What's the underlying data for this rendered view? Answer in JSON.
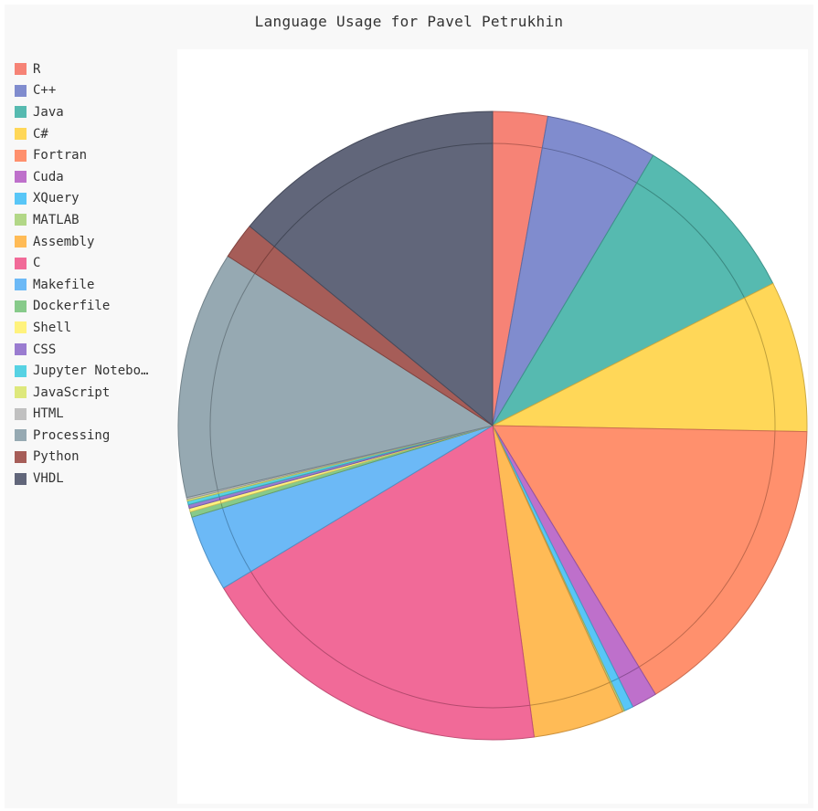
{
  "title": "Language Usage for Pavel Petrukhin",
  "chart_data": {
    "type": "pie",
    "title": "Language Usage for Pavel Petrukhin",
    "legend_position": "left",
    "slices": [
      {
        "label": "R",
        "value": 3.0,
        "color": "#F57C6F"
      },
      {
        "label": "C++",
        "value": 6.1,
        "color": "#7986CB"
      },
      {
        "label": "Java",
        "value": 9.6,
        "color": "#4DB6AC"
      },
      {
        "label": "C#",
        "value": 8.3,
        "color": "#FFD54F"
      },
      {
        "label": "Fortran",
        "value": 17.1,
        "color": "#FF8A65"
      },
      {
        "label": "Cuda",
        "value": 1.4,
        "color": "#BA68C8"
      },
      {
        "label": "XQuery",
        "value": 0.5,
        "color": "#4FC3F7"
      },
      {
        "label": "MATLAB",
        "value": 0.1,
        "color": "#AED581"
      },
      {
        "label": "Assembly",
        "value": 5.0,
        "color": "#FFB74D"
      },
      {
        "label": "C",
        "value": 19.7,
        "color": "#F06292"
      },
      {
        "label": "Makefile",
        "value": 4.2,
        "color": "#64B5F6"
      },
      {
        "label": "Dockerfile",
        "value": 0.3,
        "color": "#81C784"
      },
      {
        "label": "Shell",
        "value": 0.2,
        "color": "#FFF176"
      },
      {
        "label": "CSS",
        "value": 0.2,
        "color": "#9575CD"
      },
      {
        "label": "Jupyter Notebo…",
        "value": 0.2,
        "color": "#4DD0E1"
      },
      {
        "label": "JavaScript",
        "value": 0.1,
        "color": "#DCE775"
      },
      {
        "label": "HTML",
        "value": 0.1,
        "color": "#BDBDBD"
      },
      {
        "label": "Processing",
        "value": 13.6,
        "color": "#90A4AE"
      },
      {
        "label": "Python",
        "value": 2.0,
        "color": "#A1544F"
      },
      {
        "label": "VHDL",
        "value": 15.0,
        "color": "#585E73"
      }
    ]
  }
}
